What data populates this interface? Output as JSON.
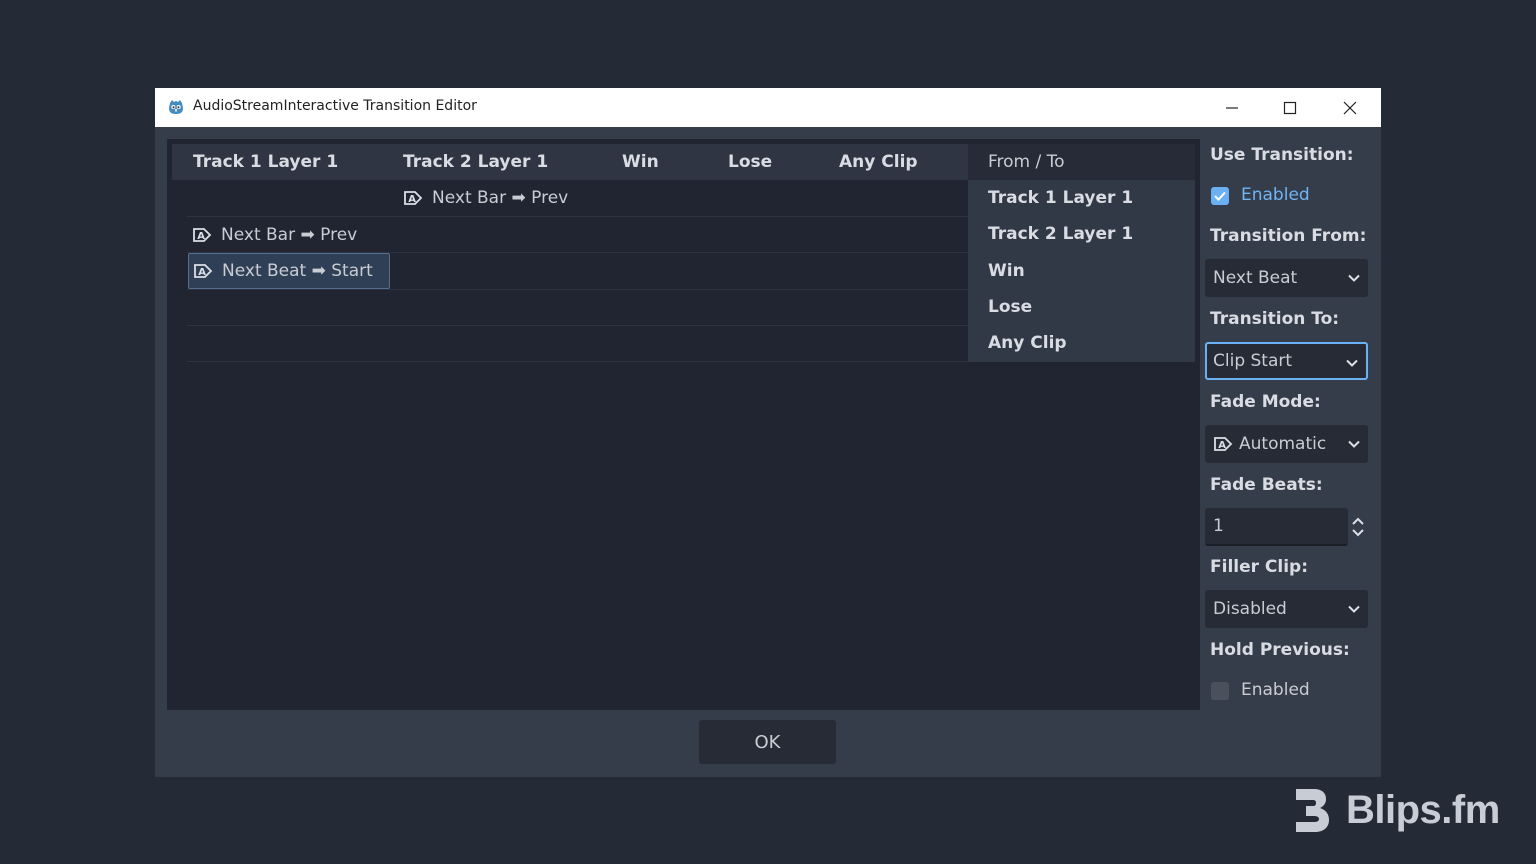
{
  "window": {
    "title": "AudioStreamInteractive Transition Editor",
    "controls": [
      "minimize-icon",
      "maximize-icon",
      "close-icon"
    ]
  },
  "grid": {
    "columns": [
      "Track 1 Layer 1",
      "Track 2 Layer 1",
      "Win",
      "Lose",
      "Any Clip"
    ],
    "corner_label": "From / To",
    "rows": [
      "Track 1 Layer 1",
      "Track 2 Layer 1",
      "Win",
      "Lose",
      "Any Clip"
    ],
    "cells": [
      {
        "row": "Track 1 Layer 1",
        "column": "Track 2 Layer 1",
        "text": "Next Bar ➡ Prev",
        "icon": "auto-fade-icon"
      },
      {
        "row": "Track 2 Layer 1",
        "column": "Track 1 Layer 1",
        "text": "Next Bar ➡ Prev",
        "icon": "auto-fade-icon"
      },
      {
        "row": "Win",
        "column": "Track 1 Layer 1",
        "text": "Next Beat ➡ Start",
        "icon": "auto-fade-icon",
        "selected": true
      }
    ]
  },
  "properties": {
    "use_transition": {
      "label": "Use Transition:",
      "checkbox_label": "Enabled",
      "checked": true
    },
    "transition_from": {
      "label": "Transition From:",
      "value": "Next Beat"
    },
    "transition_to": {
      "label": "Transition To:",
      "value": "Clip Start"
    },
    "fade_mode": {
      "label": "Fade Mode:",
      "value": "Automatic",
      "icon": "auto-fade-icon"
    },
    "fade_beats": {
      "label": "Fade Beats:",
      "value": "1"
    },
    "filler_clip": {
      "label": "Filler Clip:",
      "value": "Disabled"
    },
    "hold_previous": {
      "label": "Hold Previous:",
      "checkbox_label": "Enabled",
      "checked": false
    }
  },
  "footer": {
    "ok_label": "OK"
  },
  "branding": {
    "logo_text": "Blips.fm"
  },
  "colors": {
    "accent": "#6ab0f3",
    "background": "#252a37",
    "panel": "#202531"
  }
}
